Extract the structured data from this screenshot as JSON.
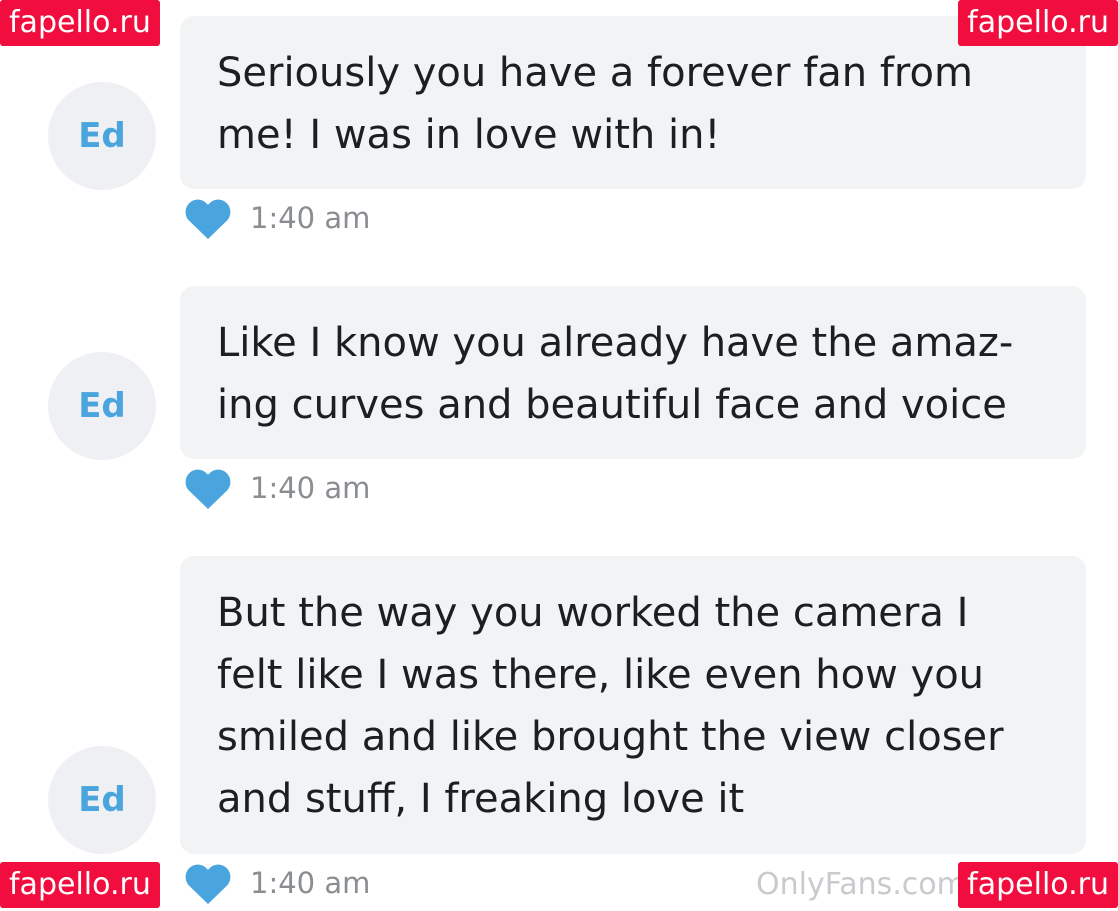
{
  "watermark": {
    "text": "fapello.ru",
    "color": "#f10d3e"
  },
  "footer": {
    "brand": "OnlyFans.com"
  },
  "accent": "#4aa4de",
  "messages": [
    {
      "avatar": "Ed",
      "text": "Seriously you have a forever fan from\nme! I was in love with in!",
      "time": "1:40 am",
      "liked": true,
      "icon": "heart-icon"
    },
    {
      "avatar": "Ed",
      "text": "Like I know you already have the amaz-\ning curves and beautiful face and voice",
      "time": "1:40 am",
      "liked": true,
      "icon": "heart-icon"
    },
    {
      "avatar": "Ed",
      "text": "But the way you worked the camera I\nfelt like I was there, like even how you\nsmiled and like brought the view closer\nand stuff, I freaking love it",
      "time": "1:40 am",
      "liked": true,
      "icon": "heart-icon"
    }
  ]
}
